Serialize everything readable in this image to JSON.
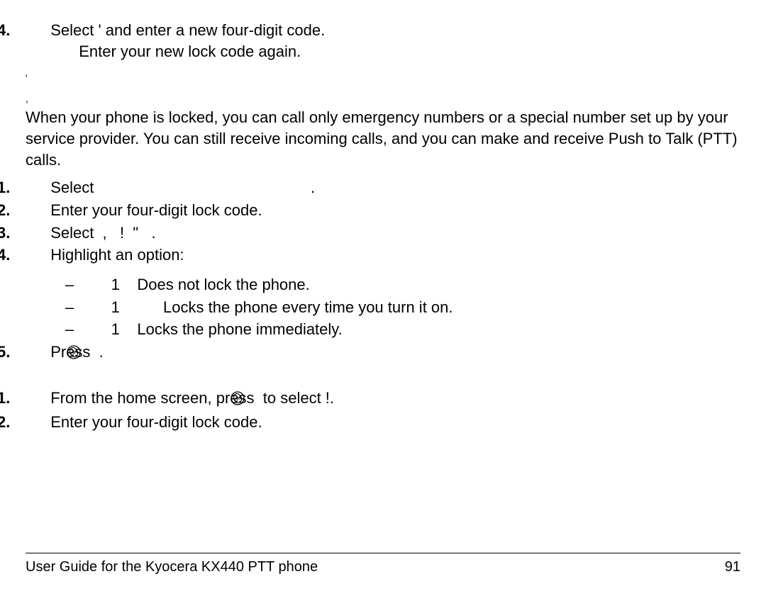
{
  "top_list_start": 4,
  "top_item": {
    "line1_a": "Select ",
    "line1_b": "'",
    "line1_c": "    and enter a new four-digit code.",
    "line2": "Enter your new lock code again."
  },
  "section_marks": {
    "l1": "'",
    "l2": ","
  },
  "intro_para": "When your phone is locked, you can call only emergency numbers or a special number set up by your service provider. You can still receive incoming calls, and you can make and receive Push to Talk (PTT) calls.",
  "steps_a": [
    {
      "n": "1.",
      "t": "Select                                                  ."
    },
    {
      "n": "2.",
      "t": "Enter your four-digit lock code."
    },
    {
      "n": "3.",
      "t": "Select  ,   !  \"   ."
    },
    {
      "n": "4.",
      "t": "Highlight an option:"
    }
  ],
  "options": [
    {
      "dash": "–",
      "mark": "1",
      "gap": "    ",
      "t": "Does not lock the phone."
    },
    {
      "dash": "–",
      "mark": "1",
      "gap": "          ",
      "t": "Locks the phone every time you turn it on."
    },
    {
      "dash": "–",
      "mark": "1",
      "gap": "    ",
      "t": "Locks the phone immediately."
    }
  ],
  "step5": {
    "n": "5.",
    "pre": "Press ",
    "post": " ."
  },
  "steps_b": [
    {
      "n": "1.",
      "pre": "From the home screen, press ",
      "mid": "  to select       !",
      "post": "."
    },
    {
      "n": "2.",
      "t": "Enter your four-digit lock code."
    }
  ],
  "footer": {
    "title": "User Guide for the Kyocera KX440 PTT phone",
    "page": "91"
  }
}
